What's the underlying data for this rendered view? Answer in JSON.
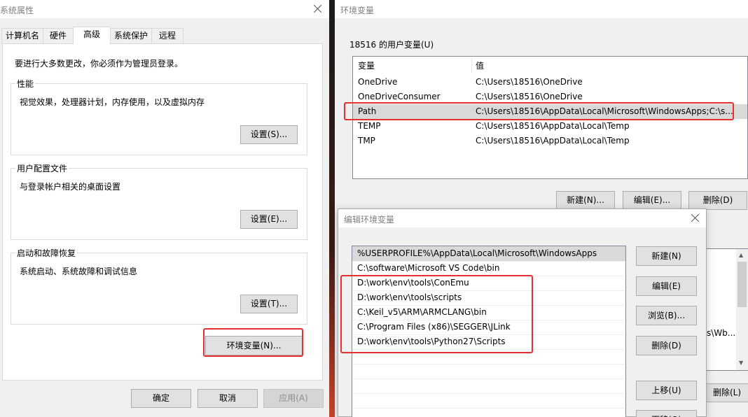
{
  "system_properties": {
    "title": "系统属性",
    "tabs": [
      "计算机名",
      "硬件",
      "高级",
      "系统保护",
      "远程"
    ],
    "admin_notice": "要进行大多数更改，你必须作为管理员登录。",
    "performance": {
      "title": "性能",
      "desc": "视觉效果，处理器计划，内存使用，以及虚拟内存",
      "button": "设置(S)..."
    },
    "user_profiles": {
      "title": "用户配置文件",
      "desc": "与登录帐户相关的桌面设置",
      "button": "设置(E)..."
    },
    "startup_recovery": {
      "title": "启动和故障恢复",
      "desc": "系统启动、系统故障和调试信息",
      "button": "设置(T)..."
    },
    "env_button": "环境变量(N)...",
    "ok": "确定",
    "cancel": "取消",
    "apply": "应用(A)"
  },
  "env_vars": {
    "title": "环境变量",
    "user_vars_label": "18516 的用户变量(U)",
    "col_var": "变量",
    "col_val": "值",
    "rows": [
      {
        "name": "OneDrive",
        "value": "C:\\Users\\18516\\OneDrive"
      },
      {
        "name": "OneDriveConsumer",
        "value": "C:\\Users\\18516\\OneDrive"
      },
      {
        "name": "Path",
        "value": "C:\\Users\\18516\\AppData\\Local\\Microsoft\\WindowsApps;C:\\s..."
      },
      {
        "name": "TEMP",
        "value": "C:\\Users\\18516\\AppData\\Local\\Temp"
      },
      {
        "name": "TMP",
        "value": "C:\\Users\\18516\\AppData\\Local\\Temp"
      }
    ],
    "new_button": "新建(N)...",
    "edit_button": "编辑(E)...",
    "delete_button": "删除(D)",
    "partial_value": "s\\Wb...",
    "partial_delete": "删除(L)"
  },
  "edit_env": {
    "title": "编辑环境变量",
    "items": [
      "%USERPROFILE%\\AppData\\Local\\Microsoft\\WindowsApps",
      "C:\\software\\Microsoft VS Code\\bin",
      "D:\\work\\env\\tools\\ConEmu",
      "D:\\work\\env\\tools\\scripts",
      "C:\\Keil_v5\\ARM\\ARMCLANG\\bin",
      "C:\\Program Files (x86)\\SEGGER\\JLink",
      "D:\\work\\env\\tools\\Python27\\Scripts"
    ],
    "new": "新建(N)",
    "edit": "编辑(E)",
    "browse": "浏览(B)...",
    "delete": "删除(D)",
    "move_up": "上移(U)",
    "move_down": "下移(O)"
  },
  "colors": {
    "highlight": "#e53030",
    "selected_row": "#d9d9d9"
  }
}
